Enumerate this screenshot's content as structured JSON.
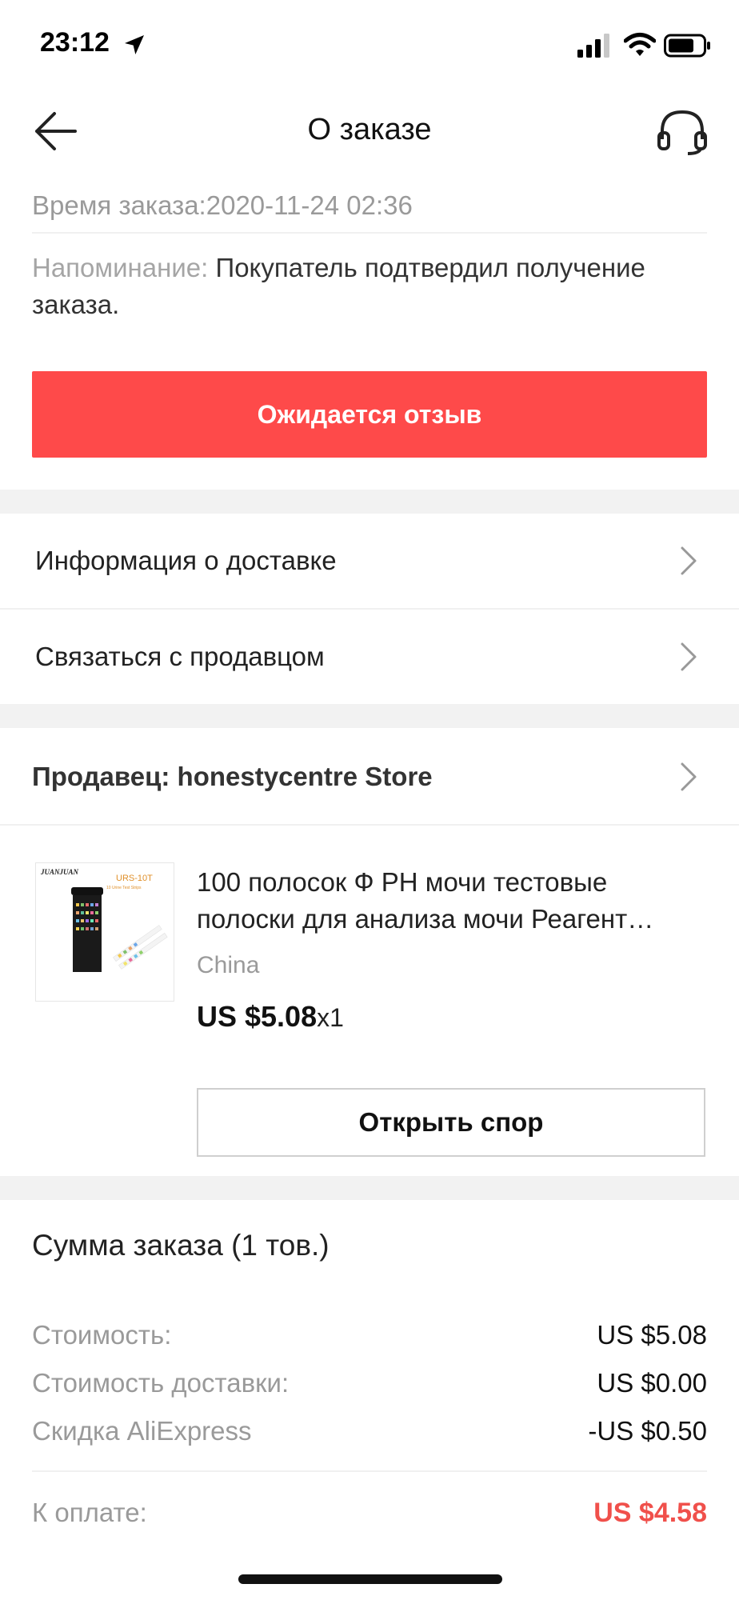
{
  "status_bar": {
    "time": "23:12"
  },
  "header": {
    "title": "О заказе"
  },
  "order": {
    "time_label": "Время заказа:",
    "time_value": "2020-11-24 02:36",
    "reminder_label": "Напоминание:",
    "reminder_text": "Покупатель подтвердил получение заказа.",
    "primary_button": "Ожидается отзыв"
  },
  "links": {
    "delivery": "Информация о доставке",
    "contact_seller": "Связаться с продавцом"
  },
  "seller": {
    "label": "Продавец: honestycentre Store"
  },
  "product": {
    "title": "100 полосок Ф PH мочи тестовые полоски для анализа мочи Реагент…",
    "origin": "China",
    "price": "US $5.08",
    "quantity": "x1",
    "thumb_brand": "JUANJUAN",
    "thumb_model": "URS-10T",
    "thumb_sub": "10 Urine Test Strips",
    "dispute_button": "Открыть спор"
  },
  "summary": {
    "title": "Сумма заказа (1 тов.)",
    "rows": [
      {
        "label": "Стоимость:",
        "value": "US $5.08"
      },
      {
        "label": "Стоимость доставки:",
        "value": "US $0.00"
      },
      {
        "label": "Скидка AliExpress",
        "value": "-US $0.50"
      }
    ],
    "total_label": "К оплате:",
    "total_value": "US $4.58"
  },
  "colors": {
    "accent": "#fe4a4a",
    "total": "#f0504b"
  },
  "icons": [
    "location-arrow-icon",
    "signal-icon",
    "wifi-icon",
    "battery-icon",
    "back-arrow-icon",
    "headset-icon",
    "chevron-right-icon"
  ]
}
